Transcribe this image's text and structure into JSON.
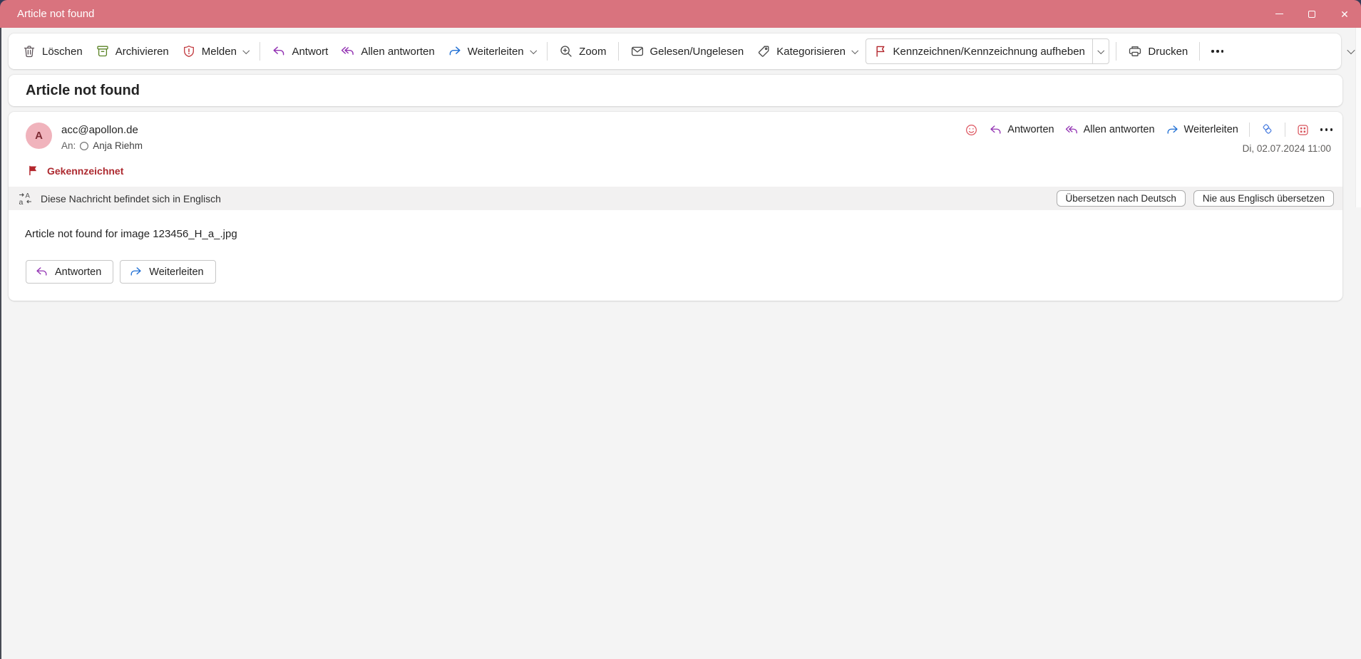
{
  "window": {
    "title": "Article not found"
  },
  "toolbar": {
    "items": [
      {
        "label": "Löschen",
        "icon": "trash-icon"
      },
      {
        "label": "Archivieren",
        "icon": "archive-box-icon"
      },
      {
        "label": "Melden",
        "icon": "report-shield-icon",
        "has_dropdown": true
      },
      {
        "label": "Antwort",
        "icon": "reply-arrow-icon"
      },
      {
        "label": "Allen antworten",
        "icon": "reply-all-arrow-icon"
      },
      {
        "label": "Weiterleiten",
        "icon": "forward-arrow-icon",
        "has_dropdown": true
      },
      {
        "label": "Zoom",
        "icon": "magnifier-zoom-icon"
      },
      {
        "label": "Gelesen/Ungelesen",
        "icon": "envelope-icon"
      },
      {
        "label": "Kategorisieren",
        "icon": "tag-icon",
        "has_dropdown": true
      },
      {
        "label": "Kennzeichnen/Kennzeichnung aufheben",
        "icon": "flag-outline-icon",
        "has_dropdown": true,
        "state": "toggled"
      },
      {
        "label": "Drucken",
        "icon": "printer-icon"
      }
    ],
    "more_icon": "more-dots-icon"
  },
  "subject": "Article not found",
  "message": {
    "avatar_letter": "A",
    "from": "acc@apollon.de",
    "to_label": "An:",
    "to_name": "Anja Riehm",
    "date": "Di, 02.07.2024 11:00",
    "header_actions": {
      "reply": "Antworten",
      "reply_all": "Allen antworten",
      "forward": "Weiterleiten"
    },
    "flag_status": "Gekennzeichnet",
    "translation": {
      "text": "Diese Nachricht befindet sich in Englisch",
      "translate_button": "Übersetzen nach Deutsch",
      "never_button": "Nie aus Englisch übersetzen"
    },
    "body": "Article not found for image 123456_H_a_.jpg",
    "footer_buttons": {
      "reply": "Antworten",
      "forward": "Weiterleiten"
    }
  },
  "colors": {
    "titlebar_pink": "#d9737e",
    "backdrop_navy": "#343b58",
    "flag_red": "#b3262c",
    "reply_purple": "#9333b3",
    "forward_blue": "#1f6fd4",
    "archive_green": "#5a8324",
    "avatar_pink": "#f0b3bc"
  }
}
